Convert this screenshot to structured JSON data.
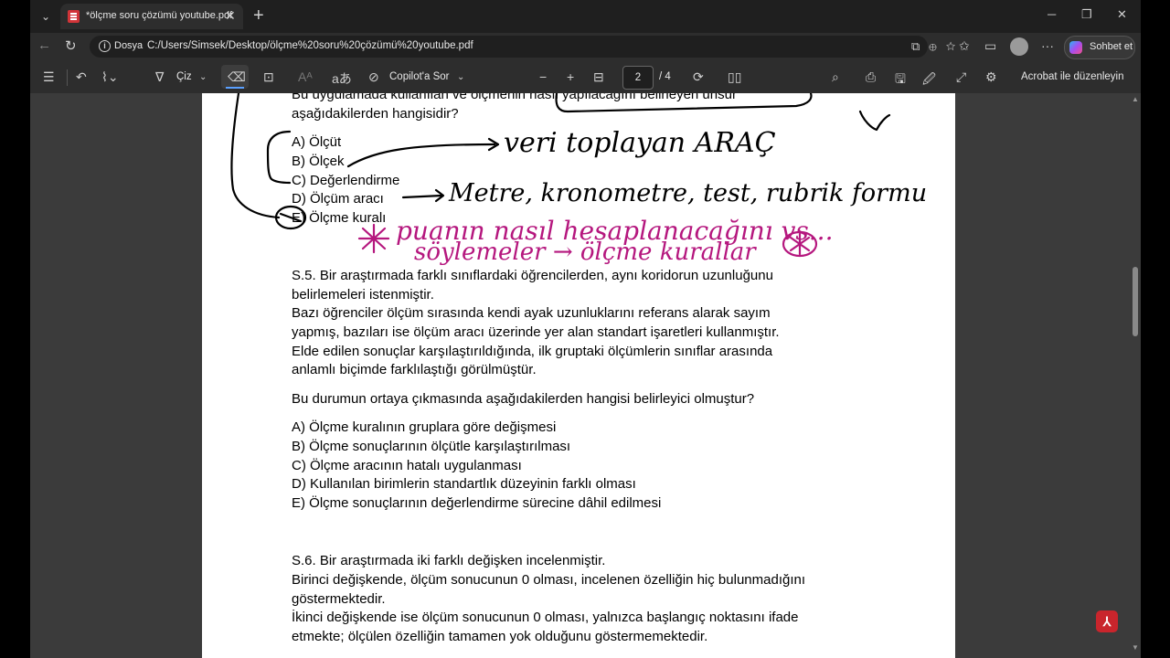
{
  "browser": {
    "tab_title": "*ölçme soru çözümü youtube.pdf",
    "address_scheme_label": "Dosya",
    "url": "C:/Users/Simsek/Desktop/ölçme%20soru%20çözümü%20youtube.pdf",
    "copilot_chat_label": "Sohbet et"
  },
  "pdf_toolbar": {
    "draw_label": "Çiz",
    "copilot_ask_label": "Copilot'a Sor",
    "page_current": "2",
    "page_total": "/ 4",
    "edit_in_acrobat_label": "Acrobat ile düzenleyin"
  },
  "document": {
    "question4": {
      "stem_line1": "Bu uygulamada kullanılan ve ölçmenin nasıl yapılacağını belirleyen unsur",
      "stem_line2": "aşağıdakilerden hangisidir?",
      "options": [
        "A) Ölçüt",
        "B) Ölçek",
        "C) Değerlendirme",
        "D) Ölçüm aracı",
        "E) Ölçme kuralı"
      ]
    },
    "question5": {
      "lines": [
        "S.5. Bir araştırmada farklı sınıflardaki öğrencilerden, aynı koridorun uzunluğunu",
        "belirlemeleri istenmiştir.",
        "Bazı öğrenciler ölçüm sırasında kendi ayak uzunluklarını referans alarak sayım",
        "yapmış, bazıları ise ölçüm aracı üzerinde yer alan standart işaretleri kullanmıştır.",
        "Elde edilen sonuçlar karşılaştırıldığında, ilk gruptaki ölçümlerin sınıflar arasında",
        "anlamlı biçimde farklılaştığı görülmüştür."
      ],
      "question": "Bu durumun ortaya çıkmasında aşağıdakilerden hangisi belirleyici olmuştur?",
      "options": [
        "A) Ölçme kuralının gruplara göre değişmesi",
        "B) Ölçme sonuçlarının ölçütle karşılaştırılması",
        "C) Ölçme aracının hatalı uygulanması",
        "D) Kullanılan birimlerin standartlık düzeyinin farklı olması",
        "E) Ölçme sonuçlarının değerlendirme sürecine dâhil edilmesi"
      ]
    },
    "question6": {
      "lines": [
        "S.6. Bir araştırmada iki farklı değişken incelenmiştir.",
        "Birinci değişkende, ölçüm sonucunun 0 olması, incelenen özelliğin hiç bulunmadığını",
        "göstermektedir.",
        "İkinci değişkende ise ölçüm sonucunun 0 olması, yalnızca başlangıç noktasını ifade",
        "etmekte; ölçülen özelliğin tamamen yok olduğunu göstermemektedir."
      ]
    },
    "annotations": {
      "note_tool": "veri toplayan ARAÇ",
      "note_examples": "Metre, kronometre, test, rubrik formu",
      "note_scoring_line1": "puanın nasıl hesaplanacağını vs...",
      "note_scoring_line2": "söylemeler → ölçme kurallar",
      "ink_black": "#000000",
      "ink_magenta": "#b5177e"
    }
  }
}
